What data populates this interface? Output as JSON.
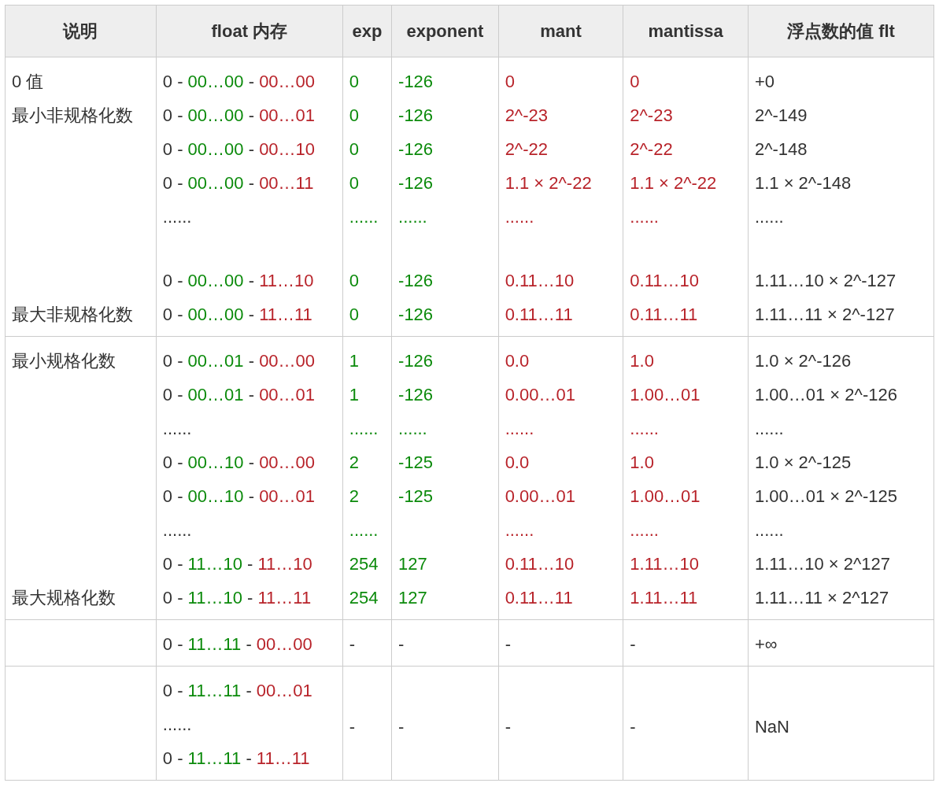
{
  "columns": [
    "说明",
    "float 内存",
    "exp",
    "exponent",
    "mant",
    "mantissa",
    "浮点数的值 flt"
  ],
  "groups": [
    {
      "rows": [
        {
          "desc": "0 值",
          "memory": [
            {
              "text": "0 - ",
              "kind": "plain"
            },
            {
              "text": "00…00",
              "kind": "exp"
            },
            {
              "text": " - ",
              "kind": "plain"
            },
            {
              "text": "00…00",
              "kind": "mant"
            }
          ],
          "exp": "0",
          "exponent": "-126",
          "mant": "0",
          "mantissa": "0",
          "flt": "+0"
        },
        {
          "desc": "最小非规格化数",
          "memory": [
            {
              "text": "0 - ",
              "kind": "plain"
            },
            {
              "text": "00…00",
              "kind": "exp"
            },
            {
              "text": " - ",
              "kind": "plain"
            },
            {
              "text": "00…01",
              "kind": "mant"
            }
          ],
          "exp": "0",
          "exponent": "-126",
          "mant": "2^-23",
          "mantissa": "2^-23",
          "flt": "2^-149"
        },
        {
          "memory": [
            {
              "text": "0 - ",
              "kind": "plain"
            },
            {
              "text": "00…00",
              "kind": "exp"
            },
            {
              "text": " - ",
              "kind": "plain"
            },
            {
              "text": "00…10",
              "kind": "mant"
            }
          ],
          "exp": "0",
          "exponent": "-126",
          "mant": "2^-22",
          "mantissa": "2^-22",
          "flt": "2^-148"
        },
        {
          "memory": [
            {
              "text": "0 - ",
              "kind": "plain"
            },
            {
              "text": "00…00",
              "kind": "exp"
            },
            {
              "text": " - ",
              "kind": "plain"
            },
            {
              "text": "00…11",
              "kind": "mant"
            }
          ],
          "exp": "0",
          "exponent": "-126",
          "mant": "1.1 × 2^-22",
          "mantissa": "1.1 × 2^-22",
          "flt": "1.1 × 2^-148"
        },
        {
          "memory": [
            {
              "text": "......",
              "kind": "plain"
            }
          ],
          "exp": "......",
          "exponent": "......",
          "mant": "......",
          "mantissa": "......",
          "flt": "......"
        },
        {
          "kind": "gap"
        },
        {
          "memory": [
            {
              "text": "0 - ",
              "kind": "plain"
            },
            {
              "text": "00…00",
              "kind": "exp"
            },
            {
              "text": " - ",
              "kind": "plain"
            },
            {
              "text": "11…10",
              "kind": "mant"
            }
          ],
          "exp": "0",
          "exponent": "-126",
          "mant": "0.11…10",
          "mantissa": "0.11…10",
          "flt": "1.11…10 × 2^-127"
        },
        {
          "desc": "最大非规格化数",
          "memory": [
            {
              "text": "0 - ",
              "kind": "plain"
            },
            {
              "text": "00…00",
              "kind": "exp"
            },
            {
              "text": " - ",
              "kind": "plain"
            },
            {
              "text": "11…11",
              "kind": "mant"
            }
          ],
          "exp": "0",
          "exponent": "-126",
          "mant": "0.11…11",
          "mantissa": "0.11…11",
          "flt": "1.11…11 × 2^-127"
        }
      ]
    },
    {
      "rows": [
        {
          "desc": "最小规格化数",
          "memory": [
            {
              "text": "0 - ",
              "kind": "plain"
            },
            {
              "text": "00…01",
              "kind": "exp"
            },
            {
              "text": " - ",
              "kind": "plain"
            },
            {
              "text": "00…00",
              "kind": "mant"
            }
          ],
          "exp": "1",
          "exponent": "-126",
          "mant": "0.0",
          "mantissa": "1.0",
          "flt": "1.0 × 2^-126"
        },
        {
          "memory": [
            {
              "text": "0 - ",
              "kind": "plain"
            },
            {
              "text": "00…01",
              "kind": "exp"
            },
            {
              "text": " - ",
              "kind": "plain"
            },
            {
              "text": "00…01",
              "kind": "mant"
            }
          ],
          "exp": "1",
          "exponent": "-126",
          "mant": "0.00…01",
          "mantissa": "1.00…01",
          "flt": "1.00…01 × 2^-126"
        },
        {
          "memory": [
            {
              "text": "......",
              "kind": "plain"
            }
          ],
          "exp": "......",
          "exponent": "......",
          "mant": "......",
          "mantissa": "......",
          "flt": "......"
        },
        {
          "memory": [
            {
              "text": "0 - ",
              "kind": "plain"
            },
            {
              "text": "00…10",
              "kind": "exp"
            },
            {
              "text": " - ",
              "kind": "plain"
            },
            {
              "text": "00…00",
              "kind": "mant"
            }
          ],
          "exp": "2",
          "exponent": "-125",
          "mant": "0.0",
          "mantissa": "1.0",
          "flt": "1.0 × 2^-125"
        },
        {
          "memory": [
            {
              "text": "0 - ",
              "kind": "plain"
            },
            {
              "text": "00…10",
              "kind": "exp"
            },
            {
              "text": " - ",
              "kind": "plain"
            },
            {
              "text": "00…01",
              "kind": "mant"
            }
          ],
          "exp": "2",
          "exponent": "-125",
          "mant": "0.00…01",
          "mantissa": "1.00…01",
          "flt": "1.00…01 × 2^-125"
        },
        {
          "memory": [
            {
              "text": "......",
              "kind": "plain"
            }
          ],
          "exp": "......",
          "mant": "......",
          "mantissa": "......",
          "flt": "......"
        },
        {
          "memory": [
            {
              "text": "0 - ",
              "kind": "plain"
            },
            {
              "text": "11…10",
              "kind": "exp"
            },
            {
              "text": " - ",
              "kind": "plain"
            },
            {
              "text": "11…10",
              "kind": "mant"
            }
          ],
          "exp": "254",
          "exponent": "127",
          "mant": "0.11…10",
          "mantissa": "1.11…10",
          "flt": "1.11…10 × 2^127"
        },
        {
          "desc": "最大规格化数",
          "memory": [
            {
              "text": "0 - ",
              "kind": "plain"
            },
            {
              "text": "11…10",
              "kind": "exp"
            },
            {
              "text": " - ",
              "kind": "plain"
            },
            {
              "text": "11…11",
              "kind": "mant"
            }
          ],
          "exp": "254",
          "exponent": "127",
          "mant": "0.11…11",
          "mantissa": "1.11…11",
          "flt": "1.11…11 × 2^127"
        }
      ]
    },
    {
      "rows": [
        {
          "kind": "special",
          "memory": [
            {
              "text": "0 - ",
              "kind": "plain"
            },
            {
              "text": "11…11",
              "kind": "exp"
            },
            {
              "text": " - ",
              "kind": "plain"
            },
            {
              "text": "00…00",
              "kind": "mant"
            }
          ],
          "exp": "-",
          "exponent": "-",
          "mant": "-",
          "mantissa": "-",
          "flt": "+∞"
        }
      ]
    },
    {
      "merged": {
        "exp": "-",
        "exponent": "-",
        "mant": "-",
        "mantissa": "-",
        "flt": "NaN"
      },
      "rows": [
        {
          "memory": [
            {
              "text": "0 - ",
              "kind": "plain"
            },
            {
              "text": "11…11",
              "kind": "exp"
            },
            {
              "text": " - ",
              "kind": "plain"
            },
            {
              "text": "00…01",
              "kind": "mant"
            }
          ]
        },
        {
          "memory": [
            {
              "text": "......",
              "kind": "plain"
            }
          ]
        },
        {
          "memory": [
            {
              "text": "0 - ",
              "kind": "plain"
            },
            {
              "text": "11…11",
              "kind": "exp"
            },
            {
              "text": " - ",
              "kind": "plain"
            },
            {
              "text": "11…11",
              "kind": "mant"
            }
          ]
        }
      ]
    }
  ]
}
